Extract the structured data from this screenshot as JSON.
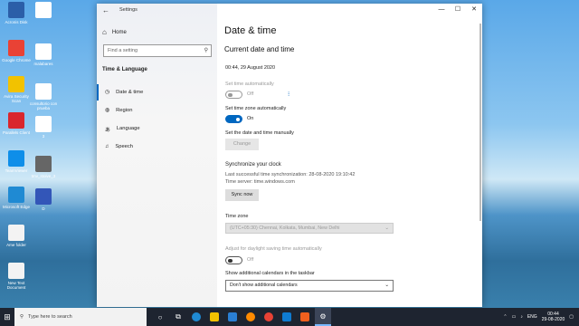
{
  "desktop": {
    "icons": [
      {
        "label": "Acronis Disk",
        "color": "#2b5ea8"
      },
      {
        "label": "",
        "color": "#ffffff"
      },
      {
        "label": "Google Chrome",
        "color": "#e94235"
      },
      {
        "label": "malabares",
        "color": "#ffffff"
      },
      {
        "label": "Avira Security Scan",
        "color": "#f2c200"
      },
      {
        "label": "consultorio con prueba",
        "color": "#ffffff"
      },
      {
        "label": "Parallels Client",
        "color": "#d9262d"
      },
      {
        "label": "3",
        "color": "#ffffff"
      },
      {
        "label": "TeamViewer",
        "color": "#0e8ee9"
      },
      {
        "label": "tmv_stoive_3",
        "color": "#666666"
      },
      {
        "label": "Microsoft Edge",
        "color": "#1f8ad3"
      },
      {
        "label": "D",
        "color": "#3356b8"
      },
      {
        "label": "Ame folder",
        "color": "#f3f3f3"
      },
      {
        "label": "New Text Document",
        "color": "#f3f3f3"
      }
    ]
  },
  "window": {
    "title": "Settings",
    "back_glyph": "←",
    "minimize": "—",
    "maximize": "☐",
    "close": "✕"
  },
  "sidebar": {
    "home_label": "Home",
    "search_placeholder": "Find a setting",
    "section_title": "Time & Language",
    "items": [
      {
        "label": "Date & time",
        "icon": "clock-icon",
        "selected": true
      },
      {
        "label": "Region",
        "icon": "globe-icon",
        "selected": false
      },
      {
        "label": "Language",
        "icon": "language-icon",
        "selected": false
      },
      {
        "label": "Speech",
        "icon": "microphone-icon",
        "selected": false
      }
    ]
  },
  "main": {
    "title": "Date & time",
    "subtitle": "Current date and time",
    "current_datetime": "00:44, 29 August 2020",
    "set_time_auto": {
      "label": "Set time automatically",
      "state": "Off",
      "on": false,
      "disabled": true
    },
    "set_zone_auto": {
      "label": "Set time zone automatically",
      "state": "On",
      "on": true
    },
    "manual": {
      "label": "Set the date and time manually",
      "button": "Change"
    },
    "sync": {
      "heading": "Synchronize your clock",
      "last_sync": "Last successful time synchronization: 28-08-2020 19:10:42",
      "server": "Time server: time.windows.com",
      "button": "Sync now"
    },
    "timezone": {
      "label": "Time zone",
      "value": "(UTC+05:30) Chennai, Kolkata, Mumbai, New Delhi"
    },
    "dst": {
      "label": "Adjust for daylight saving time automatically",
      "state": "Off",
      "on": false,
      "disabled": true
    },
    "calendars": {
      "label": "Show additional calendars in the taskbar",
      "value": "Don't show additional calendars"
    }
  },
  "taskbar": {
    "search_placeholder": "Type here to search",
    "language": "ENG",
    "time": "00:44",
    "date": "29-08-2020"
  },
  "colors": {
    "accent": "#0067c0"
  }
}
